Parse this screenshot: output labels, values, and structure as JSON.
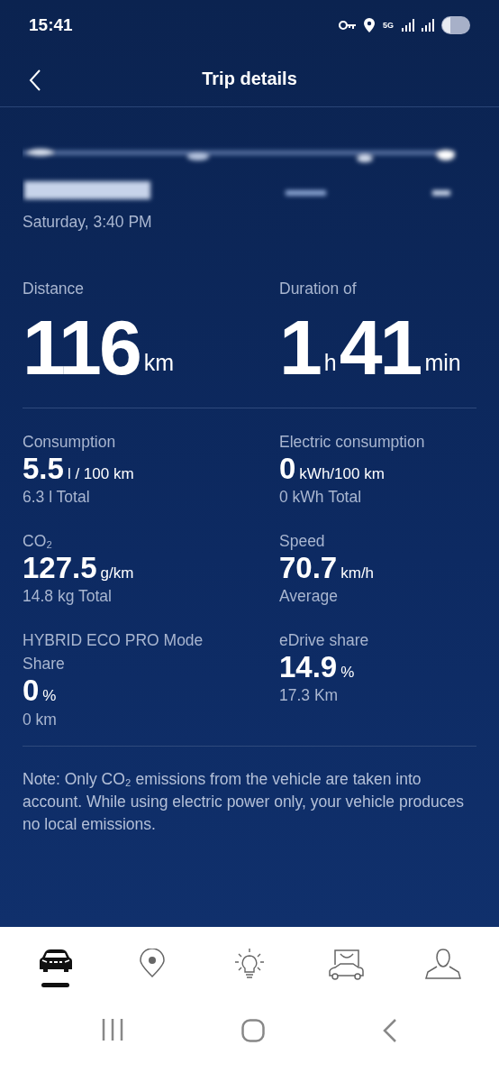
{
  "status_bar": {
    "time": "15:41",
    "network": "5G"
  },
  "header": {
    "title": "Trip details"
  },
  "trip": {
    "date": "Saturday, 3:40 PM"
  },
  "headline_stats": [
    {
      "label": "Distance",
      "parts": [
        {
          "value": "116",
          "unit": "km"
        }
      ]
    },
    {
      "label": "Duration of",
      "parts": [
        {
          "value": "1",
          "unit": "h"
        },
        {
          "value": "41",
          "unit": "min"
        }
      ]
    }
  ],
  "stats": [
    {
      "label": "Consumption",
      "value": "5.5",
      "unit": "l / 100 km",
      "detail": "6.3 l Total"
    },
    {
      "label": "Electric consumption",
      "value": "0",
      "unit": "kWh/100 km",
      "detail": "0 kWh Total"
    },
    {
      "label": "CO₂",
      "value": "127.5",
      "unit": "g/km",
      "detail": "14.8 kg Total"
    },
    {
      "label": "Speed",
      "value": "70.7",
      "unit": "km/h",
      "detail": "Average"
    },
    {
      "label": "HYBRID ECO PRO Mode Share",
      "value": "0",
      "unit": "%",
      "detail": "0 km"
    },
    {
      "label": "eDrive share",
      "value": "14.9",
      "unit": "%",
      "detail": "17.3 Km"
    }
  ],
  "note": "Note: Only CO₂ emissions from the vehicle are taken into account. While using electric power only, your vehicle produces no local emissions.",
  "bottom_nav": [
    {
      "kind": "car",
      "selected": true
    },
    {
      "kind": "pin",
      "selected": false
    },
    {
      "kind": "bulb",
      "selected": false
    },
    {
      "kind": "shop",
      "selected": false
    },
    {
      "kind": "profile",
      "selected": false
    }
  ]
}
